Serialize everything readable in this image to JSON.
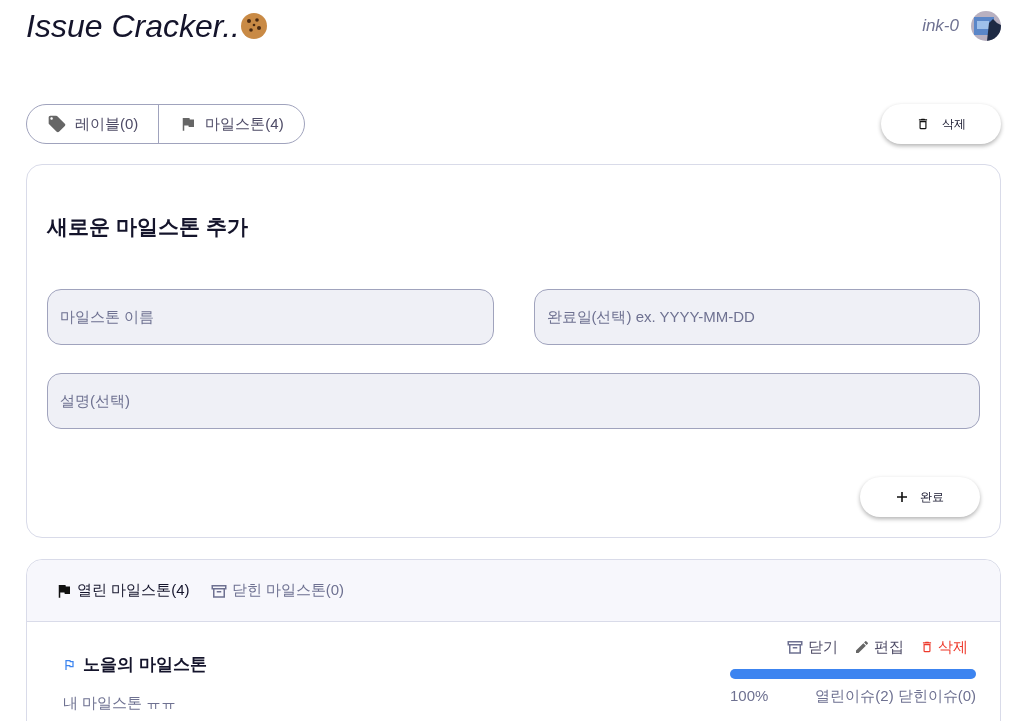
{
  "header": {
    "title": "Issue Cracker..",
    "user": "ink-0"
  },
  "nav_tabs": [
    {
      "label": "레이블(0)",
      "kind": "label"
    },
    {
      "label": "마일스톤(4)",
      "kind": "milestone"
    }
  ],
  "delete_button": "삭제",
  "form": {
    "title": "새로운 마일스톤 추가",
    "name_placeholder": "마일스톤 이름",
    "date_placeholder": "완료일(선택) ex. YYYY-MM-DD",
    "description_placeholder": "설명(선택)",
    "submit": "완료"
  },
  "milestone_tabs": [
    {
      "label": "열린 마일스톤(4)",
      "selected": true,
      "kind": "open"
    },
    {
      "label": "닫힌 마일스톤(0)",
      "selected": false,
      "kind": "closed"
    }
  ],
  "milestones": [
    {
      "title": "노을의 마일스톤",
      "description": "내 마일스톤 ㅠㅠ",
      "close": "닫기",
      "edit": "편집",
      "delete": "삭제",
      "level": 1,
      "percent": "100%",
      "open_issues": "열린이슈(2)",
      "closed_issues": "닫힌이슈(0)"
    }
  ]
}
